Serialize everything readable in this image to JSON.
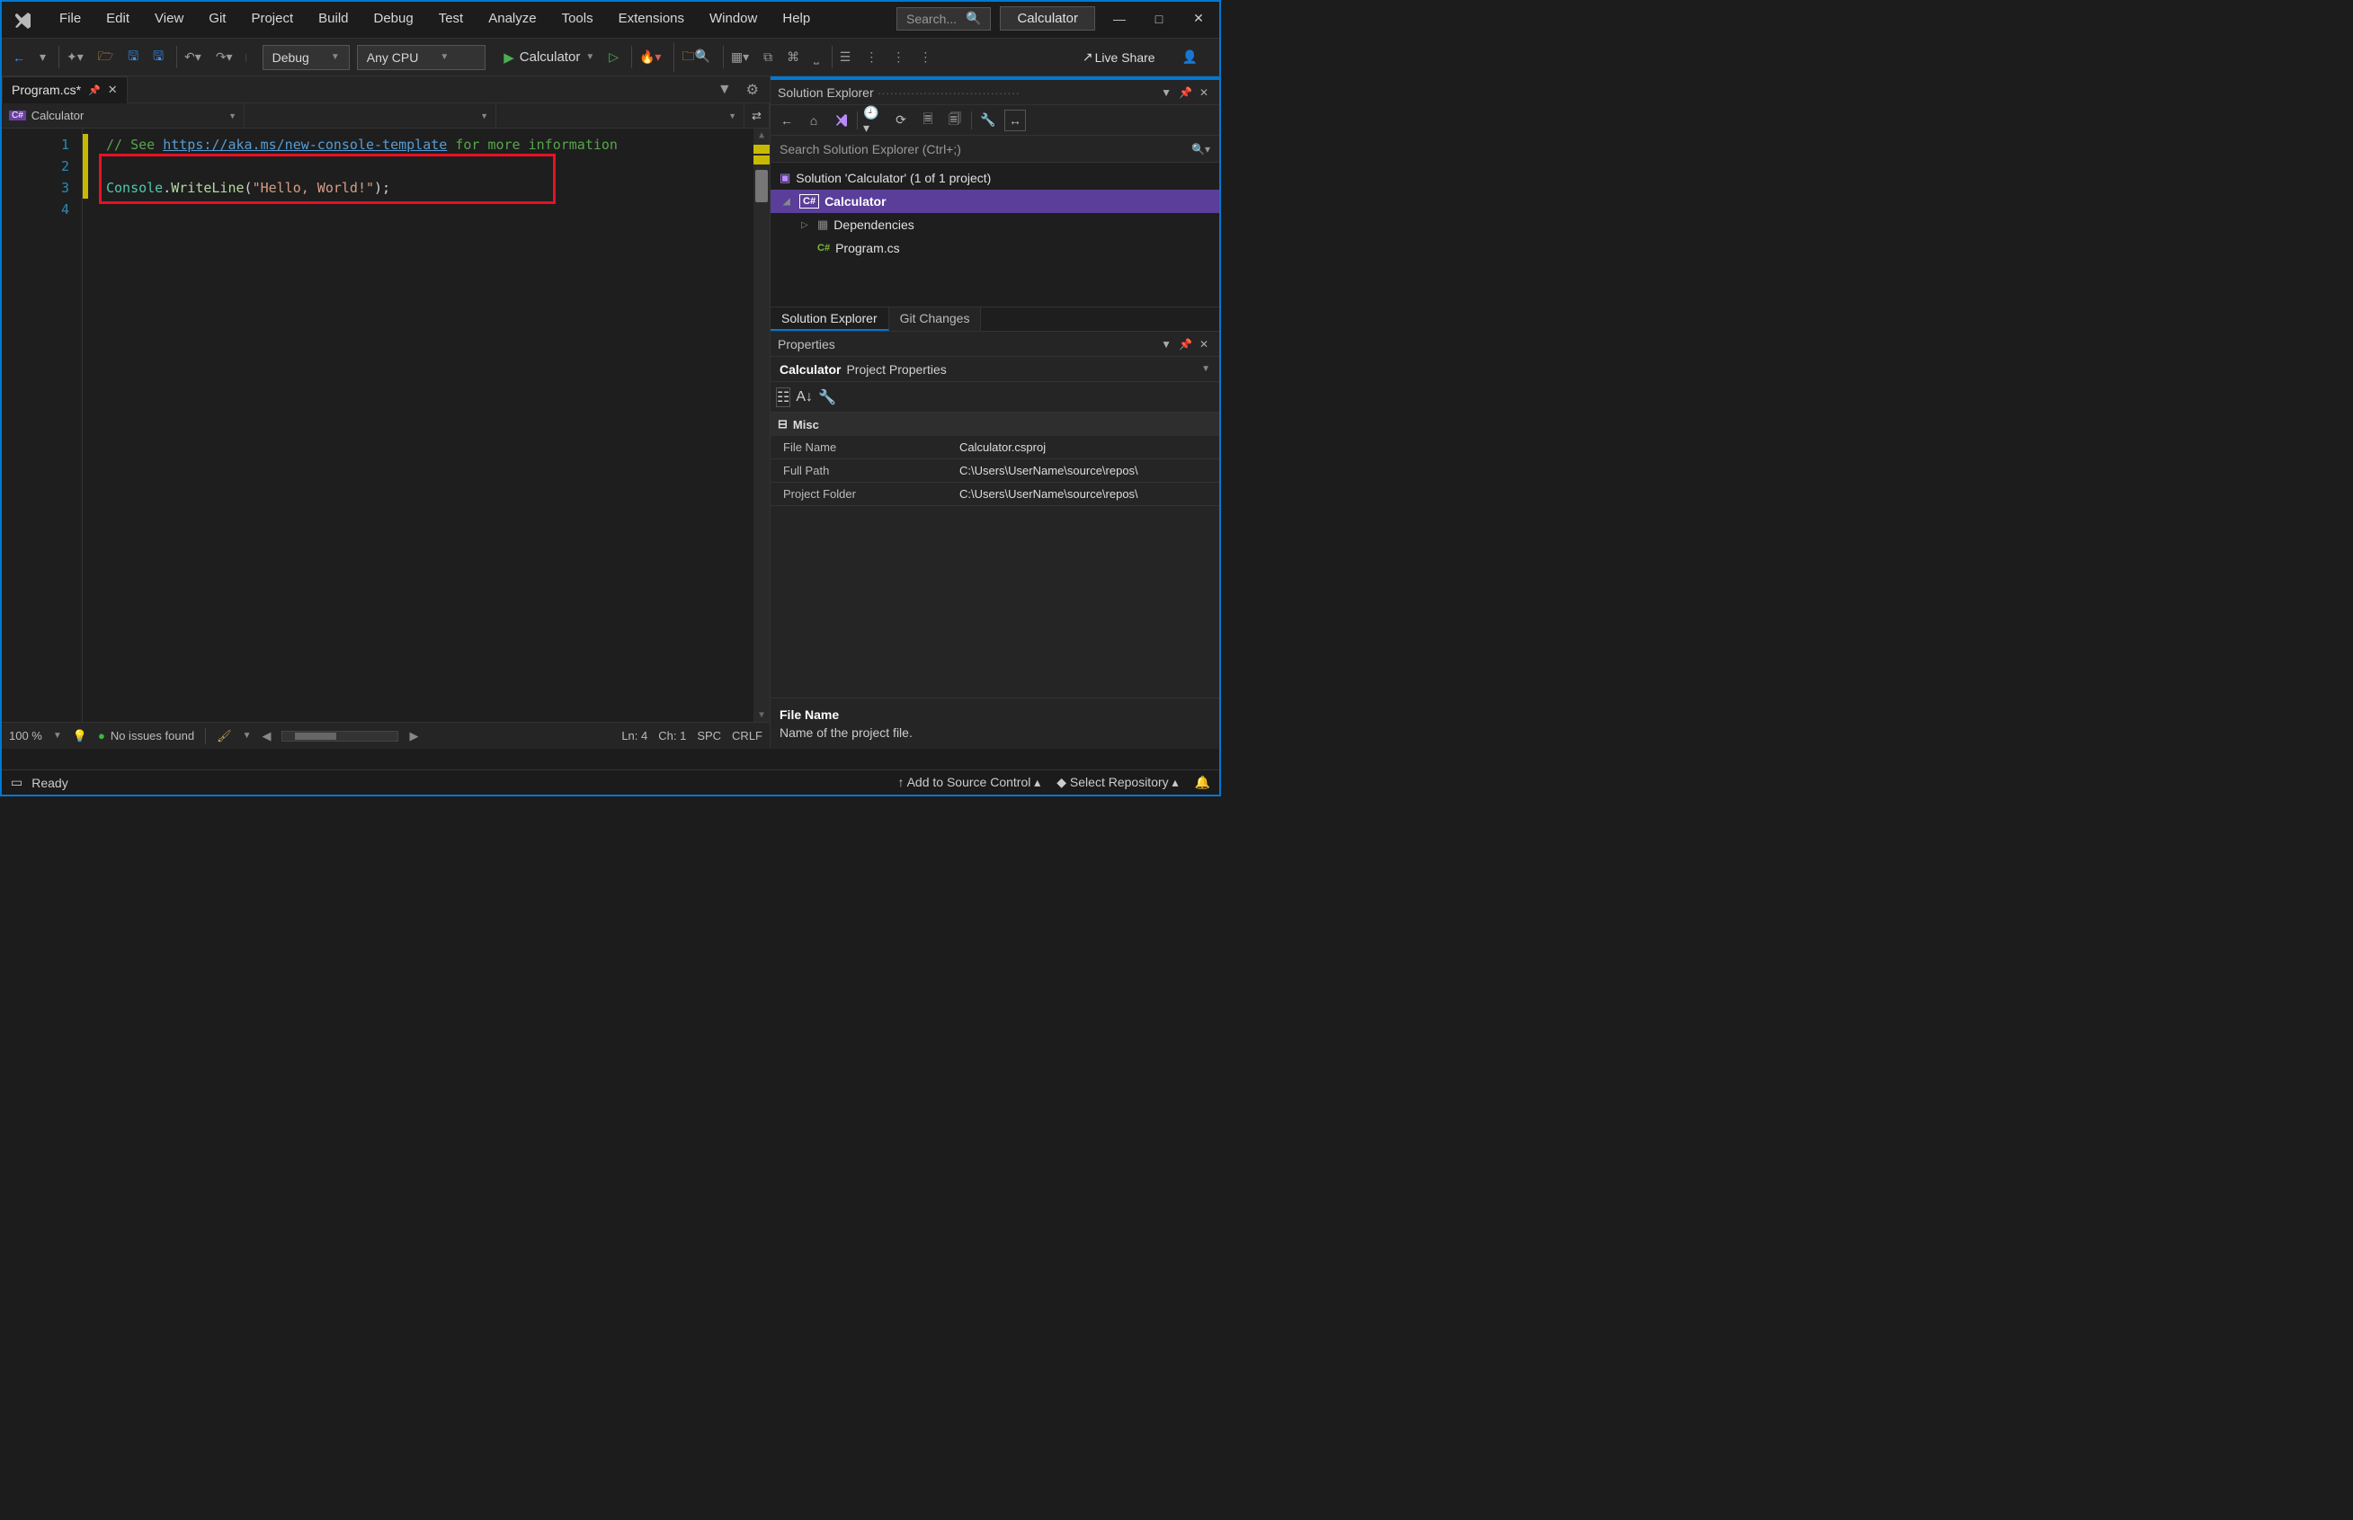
{
  "menus": [
    "File",
    "Edit",
    "View",
    "Git",
    "Project",
    "Build",
    "Debug",
    "Test",
    "Analyze",
    "Tools",
    "Extensions",
    "Window",
    "Help"
  ],
  "search_placeholder": "Search...",
  "app_title": "Calculator",
  "toolbar": {
    "config": "Debug",
    "platform": "Any CPU",
    "start_target": "Calculator",
    "live_share": "Live Share"
  },
  "tab": {
    "name": "Program.cs*"
  },
  "nav": {
    "project_lang": "C#",
    "project": "Calculator"
  },
  "code": {
    "lines": [
      "1",
      "2",
      "3",
      "4"
    ],
    "comment_prefix": "// See ",
    "link": "https://aka.ms/new-console-template",
    "comment_suffix": " for more information",
    "console": "Console",
    "dot": ".",
    "writeline": "WriteLine",
    "open": "(",
    "str": "\"Hello, World!\"",
    "close": ");"
  },
  "editor_footer": {
    "zoom": "100 %",
    "issues": "No issues found",
    "pos": "Ln: 4",
    "col": "Ch: 1",
    "ws": "SPC",
    "eol": "CRLF"
  },
  "sol_explorer": {
    "title": "Solution Explorer",
    "search_placeholder": "Search Solution Explorer (Ctrl+;)",
    "solution": "Solution 'Calculator' (1 of 1 project)",
    "project": "Calculator",
    "dependencies": "Dependencies",
    "file": "Program.cs",
    "tabs": [
      "Solution Explorer",
      "Git Changes"
    ]
  },
  "properties": {
    "title": "Properties",
    "obj_name": "Calculator",
    "obj_type": "Project Properties",
    "category": "Misc",
    "rows": [
      {
        "k": "File Name",
        "v": "Calculator.csproj"
      },
      {
        "k": "Full Path",
        "v": "C:\\Users\\UserName\\source\\repos\\"
      },
      {
        "k": "Project Folder",
        "v": "C:\\Users\\UserName\\source\\repos\\"
      }
    ],
    "desc_title": "File Name",
    "desc_text": "Name of the project file."
  },
  "status": {
    "ready": "Ready",
    "source_control": "Add to Source Control",
    "repo": "Select Repository"
  }
}
